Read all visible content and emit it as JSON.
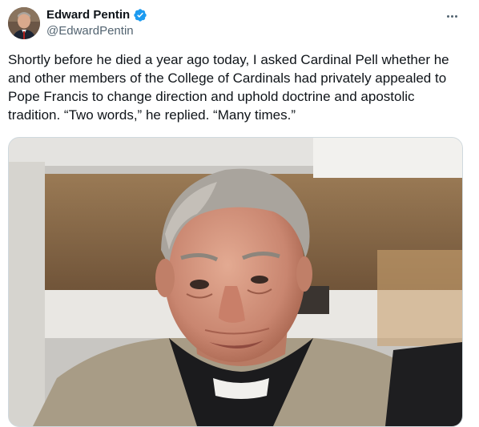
{
  "tweet": {
    "author": {
      "display_name": "Edward Pentin",
      "handle": "@EdwardPentin",
      "verified": true
    },
    "more_icon": "more-horizontal-icon",
    "text": "Shortly before he died a year ago today, I asked Cardinal Pell whether he and other members of the College of Cardinals had privately appealed to Pope Francis to change direction and uphold doctrine and apostolic tradition. “Two words,” he replied. “Many times.”",
    "media": {
      "kind": "photo"
    }
  },
  "colors": {
    "verified_badge": "#1d9bf0",
    "secondary_text": "#536471",
    "primary_text": "#0f1419",
    "media_border": "#cfd9de"
  }
}
